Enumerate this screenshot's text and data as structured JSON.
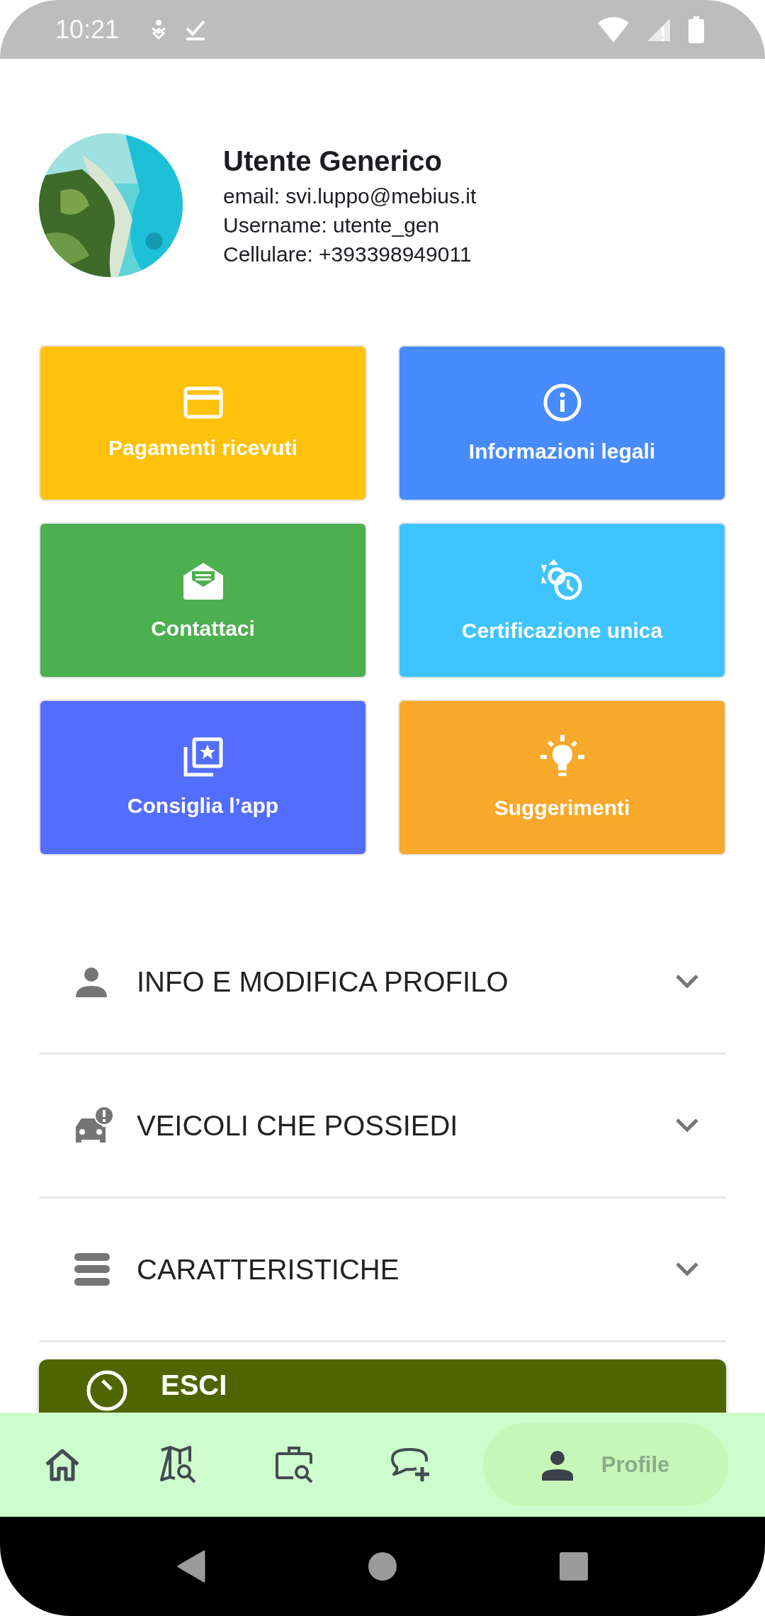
{
  "status_bar": {
    "time": "10:21"
  },
  "profile": {
    "name": "Utente Generico",
    "details": [
      "email: svi.luppo@mebius.it",
      "Username: utente_gen",
      "Cellulare: +393398949011"
    ]
  },
  "tiles": [
    {
      "label": "Pagamenti ricevuti",
      "color": "#fec20c",
      "kind": "card"
    },
    {
      "label": "Informazioni legali",
      "color": "#478bfe",
      "kind": "info"
    },
    {
      "label": "Contattaci",
      "color": "#4caf50",
      "kind": "mail"
    },
    {
      "label": "Certificazione unica",
      "color": "#40c4ff",
      "kind": "clock"
    },
    {
      "label": "Consiglia l’app",
      "color": "#536dfe",
      "kind": "star"
    },
    {
      "label": "Suggerimenti",
      "color": "#f8a82a",
      "kind": "bulb"
    }
  ],
  "sections": [
    {
      "label": "INFO E MODIFICA PROFILO",
      "kind": "person",
      "expanded": false
    },
    {
      "label": "VEICOLI CHE POSSIEDI",
      "kind": "car",
      "expanded": false
    },
    {
      "label": "CARATTERISTICHE",
      "kind": "list",
      "expanded": false
    }
  ],
  "logout_button": {
    "label": "ESCI"
  },
  "bottom_nav": [
    {
      "kind": "home",
      "selected": false
    },
    {
      "kind": "map",
      "selected": false
    },
    {
      "kind": "briefcase",
      "selected": false
    },
    {
      "kind": "chat",
      "selected": false
    },
    {
      "kind": "profile",
      "label": "Profile",
      "selected": true
    }
  ]
}
